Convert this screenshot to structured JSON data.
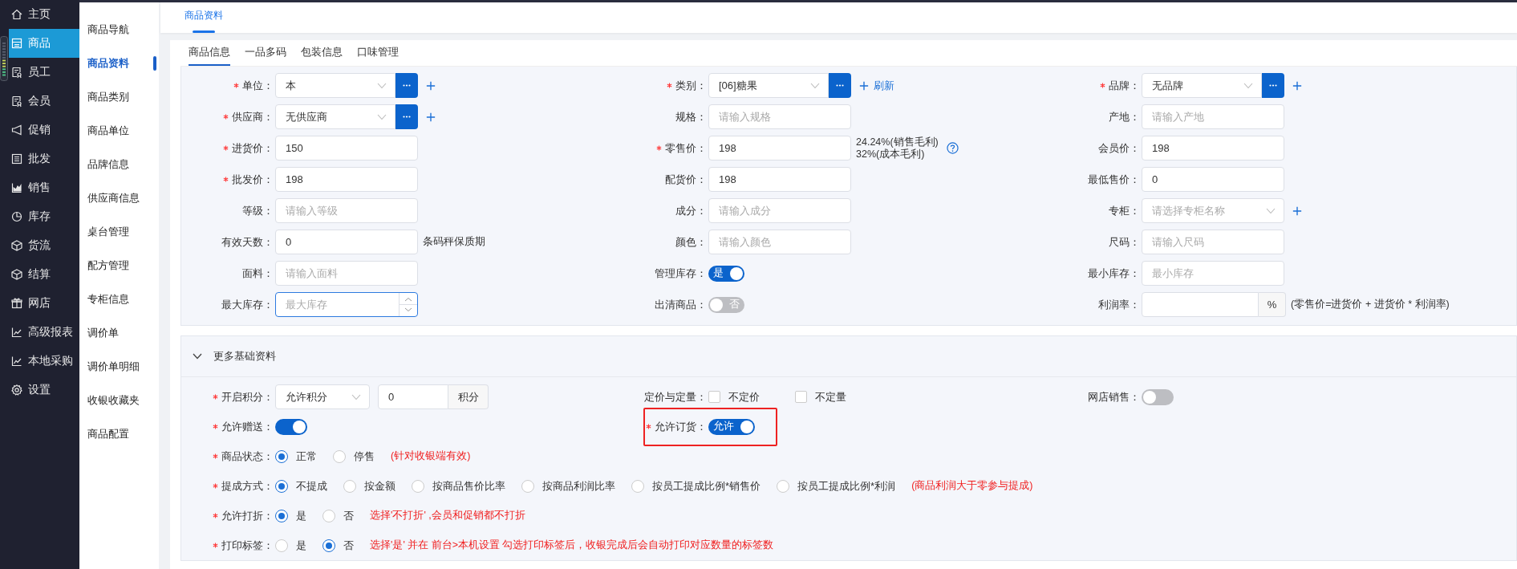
{
  "sidebar": {
    "items": [
      {
        "label": "主页",
        "kind": "home",
        "selected": false
      },
      {
        "label": "商品",
        "kind": "store",
        "selected": true
      },
      {
        "label": "员工",
        "kind": "badge",
        "selected": false
      },
      {
        "label": "会员",
        "kind": "badge",
        "selected": false
      },
      {
        "label": "促销",
        "kind": "megaphone",
        "selected": false
      },
      {
        "label": "批发",
        "kind": "list",
        "selected": false
      },
      {
        "label": "销售",
        "kind": "areachart",
        "selected": false
      },
      {
        "label": "库存",
        "kind": "pie",
        "selected": false
      },
      {
        "label": "货流",
        "kind": "cube",
        "selected": false
      },
      {
        "label": "结算",
        "kind": "cube",
        "selected": false
      },
      {
        "label": "网店",
        "kind": "gift",
        "selected": false
      },
      {
        "label": "高级报表",
        "kind": "linechart",
        "selected": false
      },
      {
        "label": "本地采购",
        "kind": "linechart",
        "selected": false
      },
      {
        "label": "设置",
        "kind": "gear",
        "selected": false
      }
    ]
  },
  "subnav": {
    "items": [
      {
        "label": "商品导航",
        "selected": false
      },
      {
        "label": "商品资料",
        "selected": true
      },
      {
        "label": "商品类别",
        "selected": false
      },
      {
        "label": "商品单位",
        "selected": false
      },
      {
        "label": "品牌信息",
        "selected": false
      },
      {
        "label": "供应商信息",
        "selected": false
      },
      {
        "label": "桌台管理",
        "selected": false
      },
      {
        "label": "配方管理",
        "selected": false
      },
      {
        "label": "专柜信息",
        "selected": false
      },
      {
        "label": "调价单",
        "selected": false
      },
      {
        "label": "调价单明细",
        "selected": false
      },
      {
        "label": "收银收藏夹",
        "selected": false
      },
      {
        "label": "商品配置",
        "selected": false
      }
    ]
  },
  "page_tabs": [
    {
      "label": "商品资料",
      "selected": true
    }
  ],
  "form_tabs": [
    {
      "label": "商品信息",
      "selected": true
    },
    {
      "label": "一品多码",
      "selected": false
    },
    {
      "label": "包装信息",
      "selected": false
    },
    {
      "label": "口味管理",
      "selected": false
    }
  ],
  "basic_form": {
    "rows": [
      [
        {
          "label": "单位：",
          "required": true,
          "kind": "select",
          "value": "本",
          "picker": true,
          "add": true
        },
        {
          "label": "类别：",
          "required": true,
          "kind": "select",
          "value": "[06]糖果",
          "picker": true,
          "add": true,
          "link": "刷新"
        },
        {
          "label": "品牌：",
          "required": true,
          "kind": "select",
          "value": "无品牌",
          "picker": true,
          "add": true
        }
      ],
      [
        {
          "label": "供应商：",
          "required": true,
          "kind": "select",
          "value": "无供应商",
          "picker": true,
          "add": true
        },
        {
          "label": "规格：",
          "required": false,
          "kind": "text",
          "placeholder": "请输入规格"
        },
        {
          "label": "产地：",
          "required": false,
          "kind": "text",
          "placeholder": "请输入产地"
        }
      ],
      [
        {
          "label": "进货价：",
          "required": true,
          "kind": "text",
          "value": "150"
        },
        {
          "label": "零售价：",
          "required": true,
          "kind": "text",
          "value": "198",
          "notes": [
            "24.24%(销售毛利)",
            "32%(成本毛利)"
          ],
          "help": true
        },
        {
          "label": "会员价：",
          "required": false,
          "kind": "text",
          "value": "198"
        }
      ],
      [
        {
          "label": "批发价：",
          "required": true,
          "kind": "text",
          "value": "198"
        },
        {
          "label": "配货价：",
          "required": false,
          "kind": "text",
          "value": "198"
        },
        {
          "label": "最低售价：",
          "required": false,
          "kind": "text",
          "value": "0"
        }
      ],
      [
        {
          "label": "等级：",
          "required": false,
          "kind": "text",
          "placeholder": "请输入等级"
        },
        {
          "label": "成分：",
          "required": false,
          "kind": "text",
          "placeholder": "请输入成分"
        },
        {
          "label": "专柜：",
          "required": false,
          "kind": "select",
          "placeholder": "请选择专柜名称",
          "add": true
        }
      ],
      [
        {
          "label": "有效天数：",
          "required": false,
          "kind": "text",
          "value": "0",
          "notes": [
            "条码秤保质期"
          ]
        },
        {
          "label": "颜色：",
          "required": false,
          "kind": "text",
          "placeholder": "请输入颜色"
        },
        {
          "label": "尺码：",
          "required": false,
          "kind": "text",
          "placeholder": "请输入尺码"
        }
      ],
      [
        {
          "label": "面料：",
          "required": false,
          "kind": "text",
          "placeholder": "请输入面料"
        },
        {
          "label": "管理库存：",
          "required": false,
          "kind": "toggle",
          "on": true,
          "text": "是"
        },
        {
          "label": "最小库存：",
          "required": false,
          "kind": "text",
          "placeholder": "最小库存"
        }
      ],
      [
        {
          "label": "最大库存：",
          "required": false,
          "kind": "number",
          "placeholder": "最大库存",
          "focused": true
        },
        {
          "label": "出清商品：",
          "required": false,
          "kind": "toggle",
          "on": false,
          "text": "否"
        },
        {
          "label": "利润率：",
          "required": false,
          "kind": "percent",
          "suffix": "%",
          "notes": [
            "(零售价=进货价 + 进货价 * 利润率)"
          ]
        }
      ]
    ]
  },
  "more_section": {
    "title": "更多基础资料",
    "expanded": true,
    "rows": [
      [
        {
          "label": "开启积分：",
          "required": true,
          "kind": "points",
          "select": "允许积分",
          "value": "0",
          "suffix": "积分"
        },
        {
          "label": "定价与定量：",
          "required": false,
          "kind": "checkboxes",
          "options": [
            {
              "label": "不定价",
              "checked": false
            },
            {
              "label": "不定量",
              "checked": false
            }
          ]
        },
        {
          "label": "网店销售：",
          "required": false,
          "kind": "toggle",
          "on": false
        }
      ],
      [
        {
          "label": "允许赠送：",
          "required": true,
          "kind": "toggle",
          "on": true
        },
        {
          "label": "允许订货：",
          "required": true,
          "kind": "toggle",
          "on": true,
          "text": "允许",
          "highlighted": true
        }
      ],
      [
        {
          "label": "商品状态：",
          "required": true,
          "kind": "radio",
          "options": [
            {
              "label": "正常",
              "selected": true
            },
            {
              "label": "停售",
              "selected": false
            }
          ],
          "note": "(针对收银端有效)"
        }
      ],
      [
        {
          "label": "提成方式：",
          "required": true,
          "kind": "radio",
          "options": [
            {
              "label": "不提成",
              "selected": true
            },
            {
              "label": "按金额",
              "selected": false
            },
            {
              "label": "按商品售价比率",
              "selected": false
            },
            {
              "label": "按商品利润比率",
              "selected": false
            },
            {
              "label": "按员工提成比例*销售价",
              "selected": false
            },
            {
              "label": "按员工提成比例*利润",
              "selected": false
            }
          ],
          "note": "(商品利润大于零参与提成)"
        }
      ],
      [
        {
          "label": "允许打折：",
          "required": true,
          "kind": "radio",
          "options": [
            {
              "label": "是",
              "selected": true
            },
            {
              "label": "否",
              "selected": false
            }
          ],
          "note": "选择'不打折' ,会员和促销都不打折"
        }
      ],
      [
        {
          "label": "打印标签：",
          "required": true,
          "kind": "radio",
          "options": [
            {
              "label": "是",
              "selected": false
            },
            {
              "label": "否",
              "selected": true
            }
          ],
          "note": "选择'是' 并在 前台>本机设置 勾选打印标签后，收银完成后会自动打印对应数量的标签数"
        }
      ]
    ]
  }
}
